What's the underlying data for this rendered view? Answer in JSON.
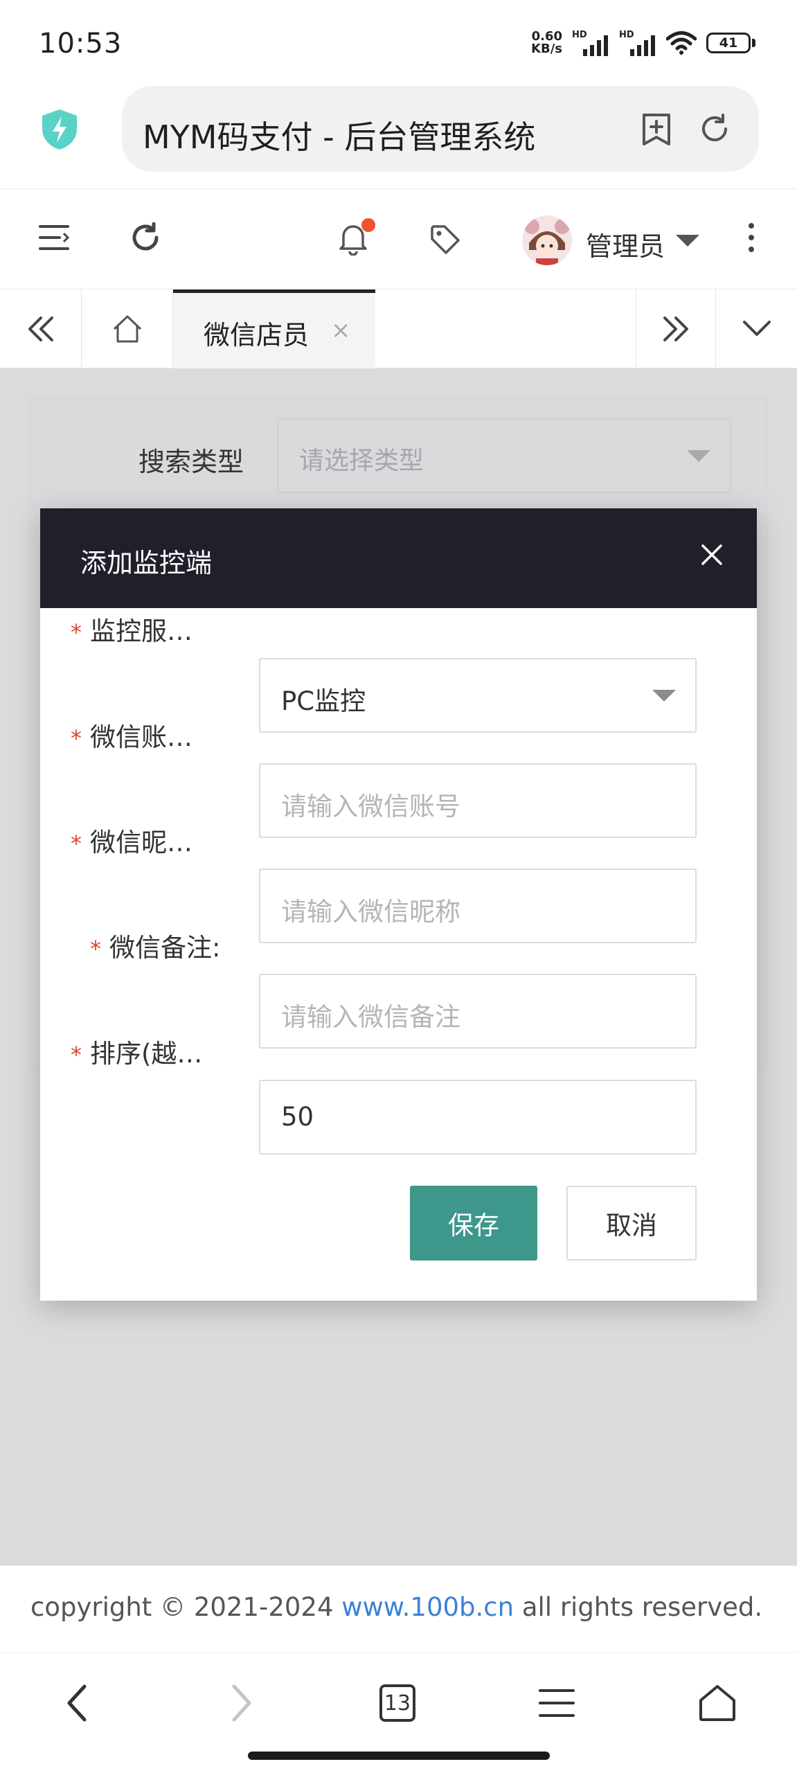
{
  "status_bar": {
    "time": "10:53",
    "net_speed_value": "0.60",
    "net_speed_unit": "KB/s",
    "hd_label": "HD",
    "battery": "41"
  },
  "browser": {
    "page_title": "MYM码支付 - 后台管理系统",
    "tab_count": "13"
  },
  "header": {
    "user_name": "管理员",
    "notification_dot_color": "#f0532d"
  },
  "tabs": {
    "active_label": "微信店员",
    "close_glyph": "×"
  },
  "background_search": {
    "label": "搜索类型",
    "placeholder": "请选择类型"
  },
  "modal": {
    "title": "添加监控端",
    "required_mark": "*",
    "fields": [
      {
        "label": "监控服…",
        "value": "PC监控",
        "type": "select"
      },
      {
        "label": "微信账…",
        "placeholder": "请输入微信账号",
        "type": "input"
      },
      {
        "label": "微信昵…",
        "placeholder": "请输入微信昵称",
        "type": "input"
      },
      {
        "label": "微信备注:",
        "placeholder": "请输入微信备注",
        "type": "input"
      },
      {
        "label": "排序(越…",
        "value": "50",
        "type": "input"
      }
    ],
    "save_label": "保存",
    "cancel_label": "取消",
    "save_color": "#3e978b",
    "header_color": "#1f2029"
  },
  "footer": {
    "prefix": "copyright © 2021-2024 ",
    "link": "www.100b.cn",
    "suffix": " all rights reserved."
  }
}
